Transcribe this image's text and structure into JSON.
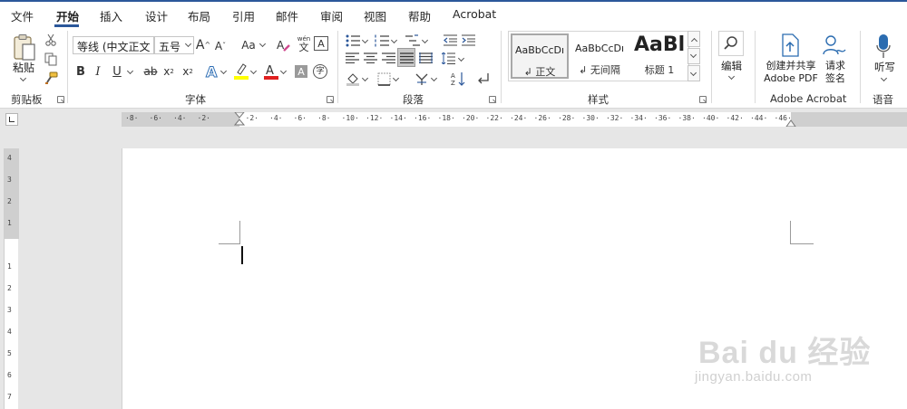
{
  "tabs": [
    "文件",
    "开始",
    "插入",
    "设计",
    "布局",
    "引用",
    "邮件",
    "审阅",
    "视图",
    "帮助",
    "Acrobat"
  ],
  "active_tab": "开始",
  "clipboard": {
    "paste_label": "粘贴",
    "group_label": "剪贴板"
  },
  "font": {
    "font_name": "等线 (中文正文",
    "font_size": "五号",
    "grow": "A",
    "shrink": "A",
    "change_case": "Aa",
    "phonetic_top": "wén",
    "phonetic_bottom": "文",
    "border_char": "A",
    "bold": "B",
    "italic": "I",
    "underline": "U",
    "strike": "ab",
    "subscript": "x",
    "superscript": "x",
    "highlight_color": "#ffff00",
    "font_color": "#e02020",
    "shading_char": "A",
    "enclose_char": "字",
    "group_label": "字体"
  },
  "paragraph": {
    "group_label": "段落"
  },
  "styles": {
    "items": [
      {
        "sample": "AaBbCcDı",
        "name": "↲ 正文"
      },
      {
        "sample": "AaBbCcDı",
        "name": "↲ 无间隔"
      },
      {
        "sample": "AaBl",
        "name": "标题 1"
      }
    ],
    "group_label": "样式"
  },
  "editing": {
    "label": "编辑"
  },
  "acrobat": {
    "create_share_line1": "创建并共享",
    "create_share_line2": "Adobe PDF",
    "request_sign_line1": "请求",
    "request_sign_line2": "签名",
    "group_label": "Adobe Acrobat"
  },
  "voice": {
    "dictate_label": "听写",
    "group_label": "语音"
  },
  "ruler": {
    "h_numbers": [
      "8",
      "6",
      "4",
      "2",
      "",
      "2",
      "4",
      "6",
      "8",
      "10",
      "12",
      "14",
      "16",
      "18",
      "20",
      "22",
      "24",
      "26",
      "28",
      "30",
      "32",
      "34",
      "36",
      "38",
      "40",
      "42",
      "44",
      "46"
    ],
    "v_numbers": [
      "4",
      "3",
      "2",
      "1",
      "",
      "1",
      "2",
      "3",
      "4",
      "5",
      "6",
      "7"
    ]
  },
  "watermark": {
    "brand": "Bai du 经验",
    "url": "jingyan.baidu.com"
  },
  "colors": {
    "accent": "#2b579a",
    "page": "#ffffff",
    "workspace": "#e6e6e6"
  }
}
